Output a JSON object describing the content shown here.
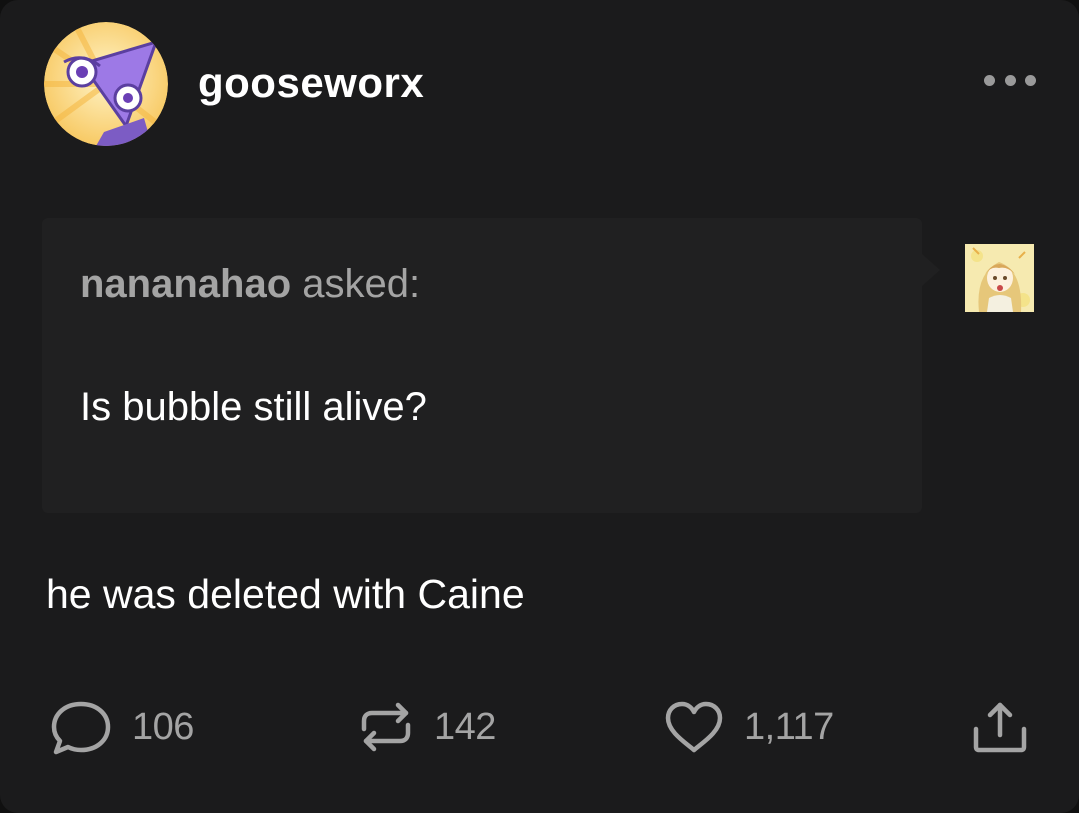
{
  "post": {
    "author": {
      "username": "gooseworx",
      "avatar_icon": "purple-triangle-character-avatar"
    },
    "more_icon": "ellipsis-icon",
    "ask": {
      "asker": "nananahao",
      "asked_label": "asked:",
      "question": "Is bubble still alive?",
      "asker_avatar_icon": "anime-character-avatar"
    },
    "answer": "he was deleted with Caine",
    "actions": {
      "replies": "106",
      "reblogs": "142",
      "likes": "1,117",
      "reply_icon": "speech-bubble-icon",
      "reblog_icon": "reblog-arrows-icon",
      "like_icon": "heart-icon",
      "share_icon": "share-icon"
    }
  },
  "colors": {
    "background": "#1b1b1c",
    "ask_background": "#202021",
    "primary_text": "#ffffff",
    "secondary_text": "#a4a4a4"
  }
}
